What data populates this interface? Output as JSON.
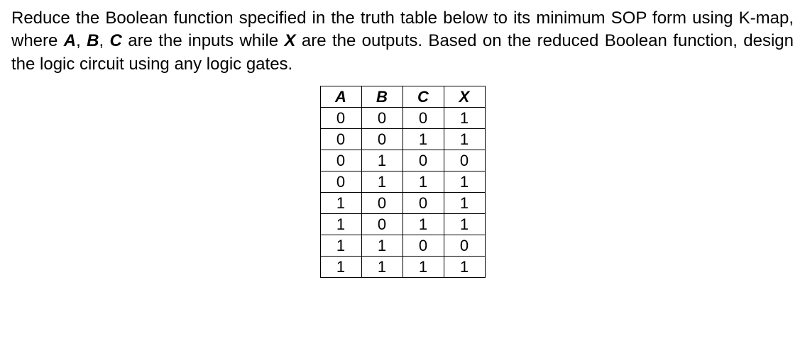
{
  "problem": {
    "line1_pre": "Reduce the Boolean function specified in the truth table below to its minimum SOP form using K-map, where ",
    "varA": "A",
    "sep1": ", ",
    "varB": "B",
    "sep2": ", ",
    "varC": "C",
    "mid": " are the inputs while ",
    "varX": "X",
    "after": " are the outputs. Based on the reduced Boolean function, design the logic circuit using any logic gates."
  },
  "table": {
    "headers": [
      "A",
      "B",
      "C",
      "X"
    ],
    "rows": [
      [
        "0",
        "0",
        "0",
        "1"
      ],
      [
        "0",
        "0",
        "1",
        "1"
      ],
      [
        "0",
        "1",
        "0",
        "0"
      ],
      [
        "0",
        "1",
        "1",
        "1"
      ],
      [
        "1",
        "0",
        "0",
        "1"
      ],
      [
        "1",
        "0",
        "1",
        "1"
      ],
      [
        "1",
        "1",
        "0",
        "0"
      ],
      [
        "1",
        "1",
        "1",
        "1"
      ]
    ]
  }
}
